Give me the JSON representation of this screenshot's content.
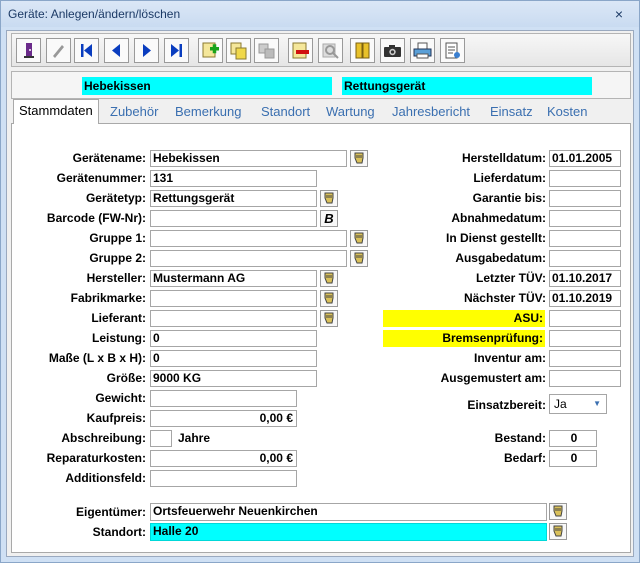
{
  "window": {
    "title": "Geräte: Anlegen/ändern/löschen",
    "close": "×"
  },
  "toolbar": {
    "icons": [
      "exit-icon",
      "edit-icon",
      "first-record-icon",
      "previous-record-icon",
      "next-record-icon",
      "last-record-icon",
      "new-record-icon",
      "copy-record-icon",
      "copy-disabled-icon",
      "delete-record-icon",
      "search-disabled-icon",
      "folder-icon",
      "camera-icon",
      "print-icon",
      "report-icon"
    ]
  },
  "header": {
    "name": "Hebekissen",
    "type": "Rettungsgerät"
  },
  "tabs": [
    "Stammdaten",
    "Zubehör",
    "Bemerkung",
    "Standort",
    "Wartung",
    "Jahresbericht",
    "Einsatz",
    "Kosten"
  ],
  "left": {
    "geraetename": {
      "label": "Gerätename:",
      "value": "Hebekissen"
    },
    "geraetenummer": {
      "label": "Gerätenummer:",
      "value": "131"
    },
    "geraetetyp": {
      "label": "Gerätetyp:",
      "value": "Rettungsgerät"
    },
    "barcode": {
      "label": "Barcode (FW-Nr):",
      "value": "",
      "button": "B"
    },
    "gruppe1": {
      "label": "Gruppe 1:",
      "value": ""
    },
    "gruppe2": {
      "label": "Gruppe 2:",
      "value": ""
    },
    "hersteller": {
      "label": "Hersteller:",
      "value": "Mustermann AG"
    },
    "fabrikmarke": {
      "label": "Fabrikmarke:",
      "value": ""
    },
    "lieferant": {
      "label": "Lieferant:",
      "value": ""
    },
    "leistung": {
      "label": "Leistung:",
      "value": "0"
    },
    "masse": {
      "label": "Maße (L x B x H):",
      "value": "0"
    },
    "groesse": {
      "label": "Größe:",
      "value": "9000 KG"
    },
    "gewicht": {
      "label": "Gewicht:",
      "value": ""
    },
    "kaufpreis": {
      "label": "Kaufpreis:",
      "value": "0,00 €"
    },
    "abschreibung": {
      "label": "Abschreibung:",
      "value": "",
      "unit": "Jahre"
    },
    "reparaturkosten": {
      "label": "Reparaturkosten:",
      "value": "0,00 €"
    },
    "additionsfeld": {
      "label": "Additionsfeld:",
      "value": ""
    }
  },
  "right": {
    "herstelldatum": {
      "label": "Herstelldatum:",
      "value": "01.01.2005"
    },
    "lieferdatum": {
      "label": "Lieferdatum:",
      "value": ""
    },
    "garantie": {
      "label": "Garantie bis:",
      "value": ""
    },
    "abnahmedatum": {
      "label": "Abnahmedatum:",
      "value": ""
    },
    "indienst": {
      "label": "In Dienst gestellt:",
      "value": ""
    },
    "ausgabedatum": {
      "label": "Ausgabedatum:",
      "value": ""
    },
    "letzter_tuev": {
      "label": "Letzter TÜV:",
      "value": "01.10.2017"
    },
    "naechster_tuev": {
      "label": "Nächster TÜV:",
      "value": "01.10.2019"
    },
    "asu": {
      "label": "ASU:",
      "value": ""
    },
    "bremsen": {
      "label": "Bremsenprüfung:",
      "value": ""
    },
    "inventur": {
      "label": "Inventur am:",
      "value": ""
    },
    "ausgemustert": {
      "label": "Ausgemustert am:",
      "value": ""
    },
    "einsatzbereit": {
      "label": "Einsatzbereit:",
      "value": "Ja"
    },
    "bestand": {
      "label": "Bestand:",
      "value": "0"
    },
    "bedarf": {
      "label": "Bedarf:",
      "value": "0"
    }
  },
  "bottom": {
    "eigentuemer": {
      "label": "Eigentümer:",
      "value": "Ortsfeuerwehr Neuenkirchen"
    },
    "standort": {
      "label": "Standort:",
      "value": "Halle 20"
    }
  },
  "colors": {
    "cyan": "#00ffff",
    "yellow": "#ffff00",
    "tab_text": "#3a6fb0"
  }
}
